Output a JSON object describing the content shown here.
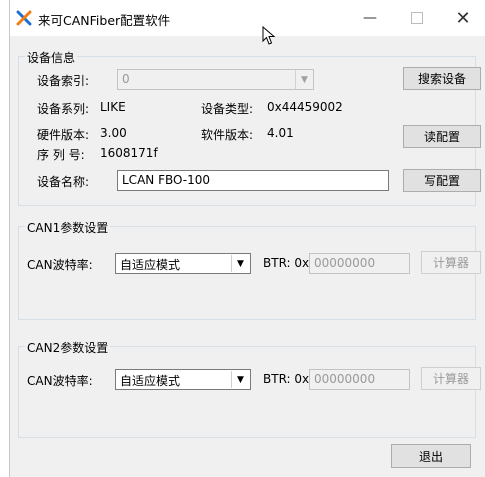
{
  "window": {
    "title": "来可CANFiber配置软件",
    "min_glyph": "—",
    "close_glyph": "✕"
  },
  "device_info": {
    "group_title": "设备信息",
    "index_label": "设备索引:",
    "index_value": "0",
    "series_label": "设备系列:",
    "series_value": "LIKE",
    "type_label": "设备类型:",
    "type_value": "0x44459002",
    "hw_label": "硬件版本:",
    "hw_value": "3.00",
    "sw_label": "软件版本:",
    "sw_value": "4.01",
    "serial_label": "序 列 号:",
    "serial_value": "1608171f",
    "name_label": "设备名称:",
    "name_value": "LCAN FBO-100",
    "search_button": "搜索设备",
    "read_button": "读配置",
    "write_button": "写配置"
  },
  "can1": {
    "group_title": "CAN1参数设置",
    "baud_label": "CAN波特率:",
    "baud_value": "自适应模式",
    "btr_label": "BTR: 0x",
    "btr_value": "00000000",
    "calc_button": "计算器"
  },
  "can2": {
    "group_title": "CAN2参数设置",
    "baud_label": "CAN波特率:",
    "baud_value": "自适应模式",
    "btr_label": "BTR: 0x",
    "btr_value": "00000000",
    "calc_button": "计算器"
  },
  "footer": {
    "exit_button": "退出"
  },
  "colors": {
    "window_bg": "#f0f0f0",
    "titlebar_bg": "#ffffff",
    "icon_blue": "#1f6fd1",
    "icon_orange": "#f07c12"
  }
}
